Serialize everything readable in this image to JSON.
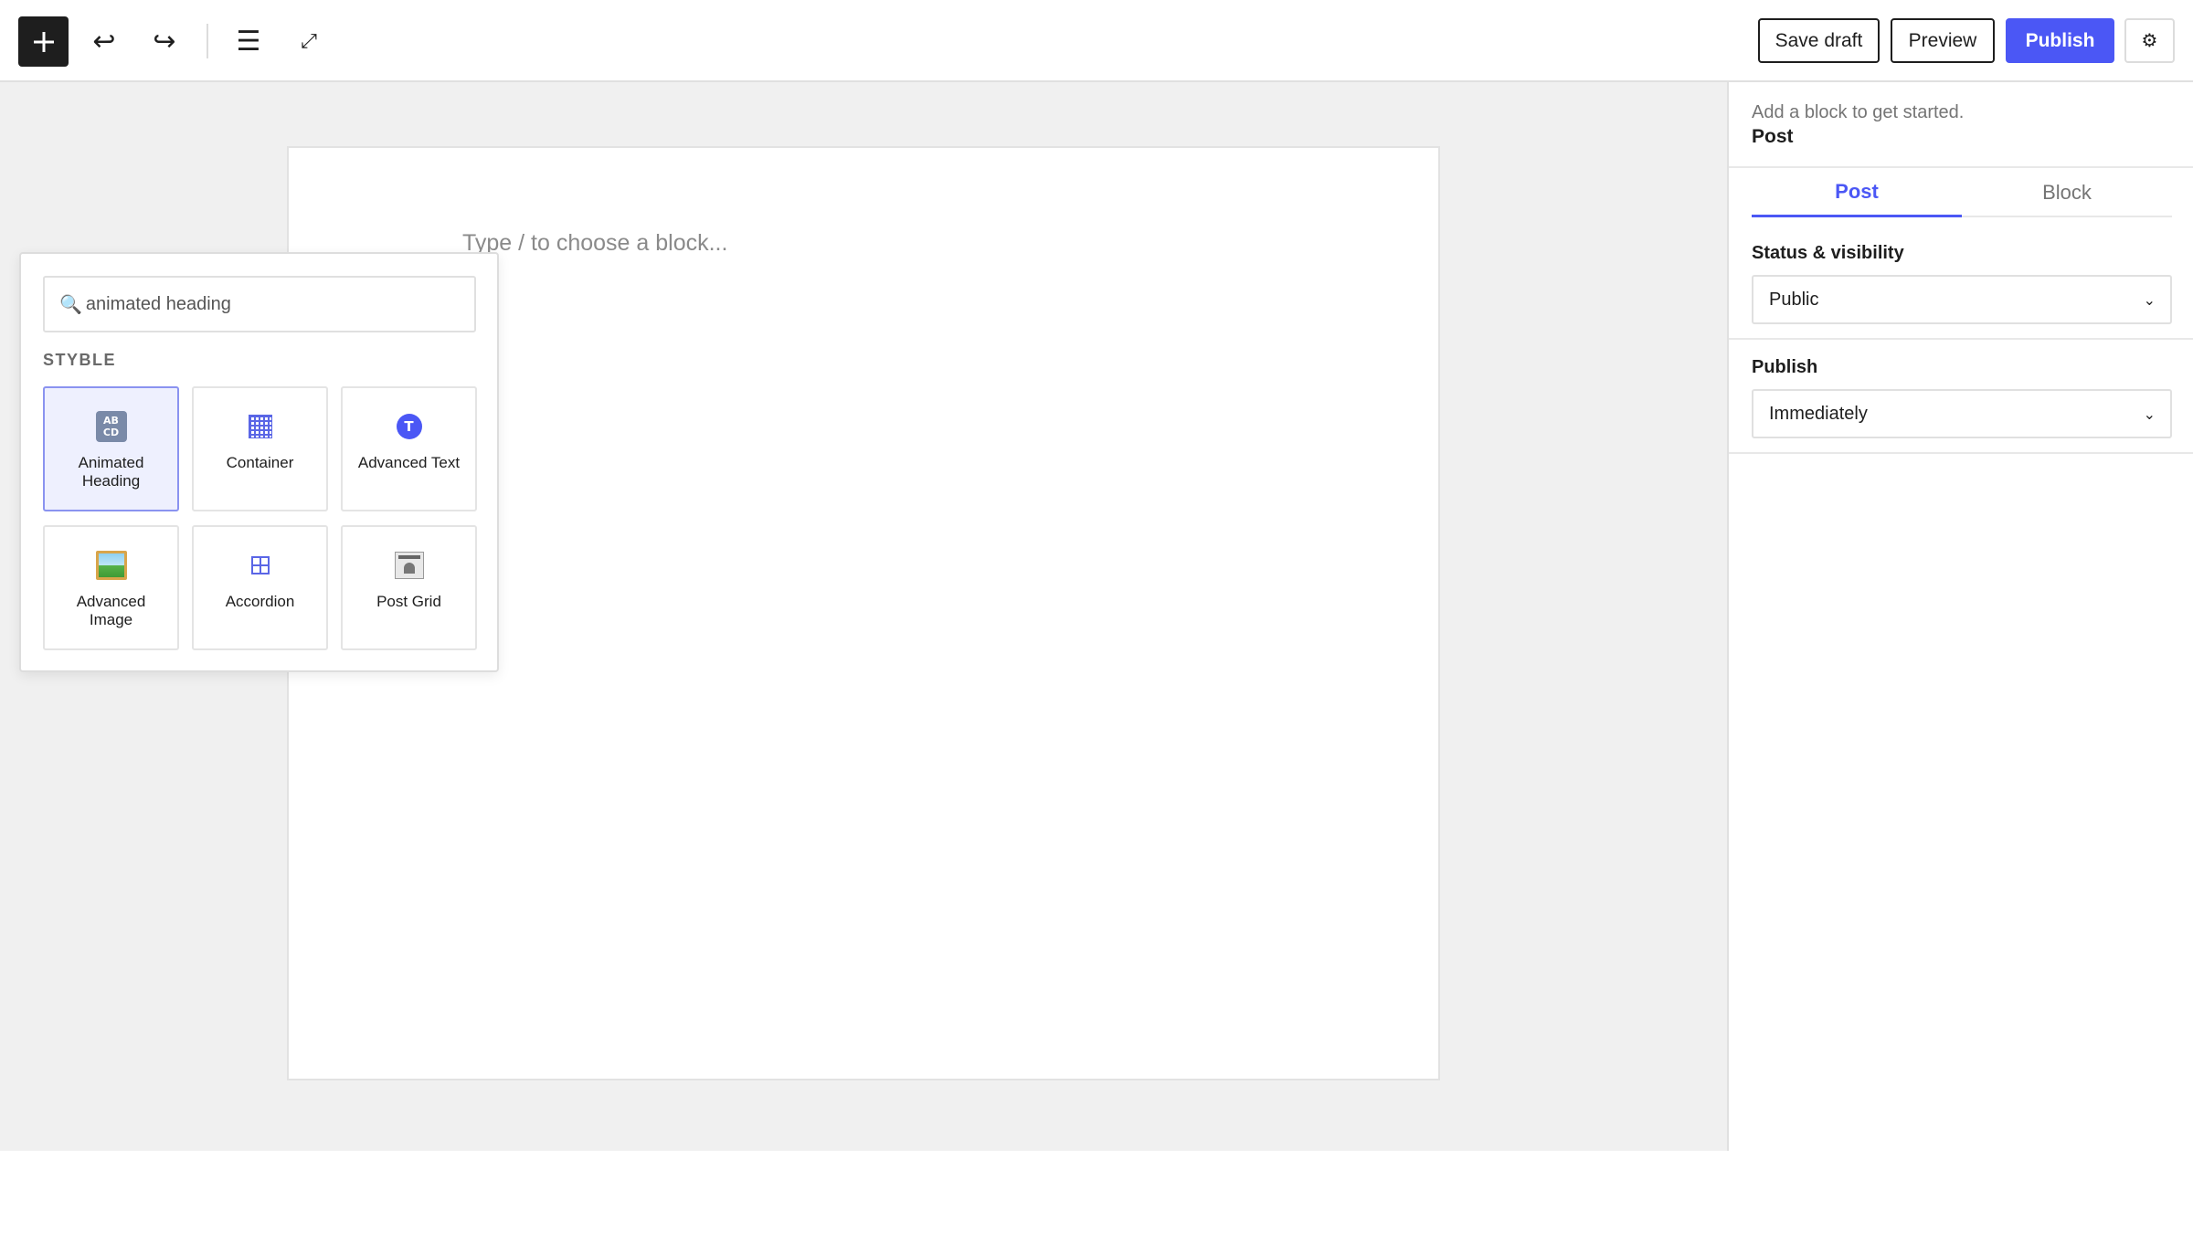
{
  "toolbar": {
    "add_icon": "plus-icon",
    "undo_glyph": "↩",
    "redo_glyph": "↪",
    "list_view_glyph": "☰",
    "fullscreen_glyph": "⤢",
    "save_draft_label": "Save draft",
    "preview_label": "Preview",
    "publish_label": "Publish",
    "settings_glyph": "⚙"
  },
  "editor": {
    "placeholder_hint": "Type / to choose a block..."
  },
  "inserter": {
    "search_value": "animated heading",
    "search_glyph": "🔍",
    "category_label": "STYBLE",
    "blocks": [
      {
        "label": "Animated Heading",
        "icon": "animated-heading-icon",
        "icon_text": "AB CD",
        "selected": true
      },
      {
        "label": "Container",
        "icon": "container-icon",
        "selected": false
      },
      {
        "label": "Advanced Text",
        "icon": "advanced-text-icon",
        "icon_text": "T",
        "selected": false
      },
      {
        "label": "Advanced Image",
        "icon": "advanced-image-icon",
        "selected": false
      },
      {
        "label": "Accordion",
        "icon": "accordion-icon",
        "selected": false
      },
      {
        "label": "Post Grid",
        "icon": "post-grid-icon",
        "selected": false
      }
    ]
  },
  "sidebar": {
    "hint": "Add a block to get started.",
    "title": "Post",
    "tabs": [
      {
        "label": "Post",
        "active": true
      },
      {
        "label": "Block",
        "active": false
      }
    ],
    "status_label": "Status & visibility",
    "status_value": "Public",
    "publish_label": "Publish",
    "publish_value": "Immediately",
    "chevron_glyph": "⌄"
  },
  "colors": {
    "accent": "#4b57f5",
    "canvas_bg": "#f0f0f0",
    "selected_tile_bg": "#eef0fe"
  }
}
